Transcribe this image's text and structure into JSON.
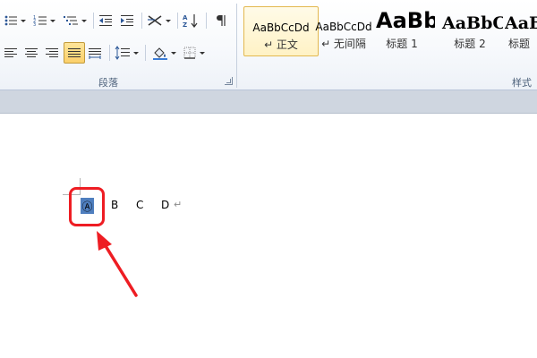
{
  "ribbon": {
    "paragraph_group_label": "段落",
    "styles_group_label": "样式",
    "styles": [
      {
        "sample": "AaBbCcDd",
        "name": "↵ 正文",
        "selected": true
      },
      {
        "sample": "AaBbCcDd",
        "name": "↵ 无间隔",
        "selected": false
      },
      {
        "sample": "AaBb",
        "name": "标题 1",
        "selected": false
      },
      {
        "sample": "AaBbC",
        "name": "标题 2",
        "selected": false
      },
      {
        "sample": "AaBb",
        "name": "标题",
        "selected": false
      }
    ]
  },
  "document": {
    "circled_letter": "Ⓐ",
    "letters": [
      "B",
      "C",
      "D"
    ],
    "paragraph_mark": "↵"
  },
  "colors": {
    "annotation_red": "#ee1d23",
    "selection_blue": "#4f7fbf",
    "ribbon_label": "#4c607a"
  }
}
